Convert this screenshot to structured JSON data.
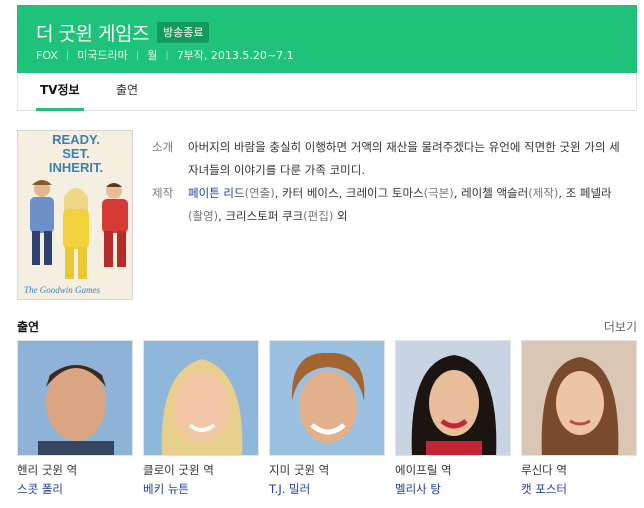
{
  "header": {
    "title": "더 굿윈 게임즈",
    "badge": "방송종료",
    "meta": [
      "FOX",
      "미국드라마",
      "월",
      "7부작, 2013.5.20~7.1"
    ],
    "color": "#1ec27a"
  },
  "tabs": [
    {
      "label": "TV정보",
      "active": true
    },
    {
      "label": "출연",
      "active": false
    }
  ],
  "poster": {
    "headline": [
      "READY.",
      "SET.",
      "INHERIT."
    ],
    "logo_text": "The Goodwin Games"
  },
  "info": {
    "synopsis_label": "소개",
    "synopsis": "아버지의 바람을 충실히 이행하면 거액의 재산을 물려주겠다는 유언에 직면한 굿윈 가의 세 자녀들의 이야기를 다룬 가족 코미디.",
    "credits_label": "제작",
    "credits": [
      {
        "name": "페이튼 리드",
        "role": "(연출)",
        "linked": true
      },
      {
        "name": "카터 베이스",
        "role": "",
        "linked": false
      },
      {
        "name": "크레이그 토마스",
        "role": "(극본)",
        "linked": false
      },
      {
        "name": "레이첼 액슬러",
        "role": "(제작)",
        "linked": false
      },
      {
        "name": "조 페넬라",
        "role": "(촬영)",
        "linked": false
      },
      {
        "name": "크리스토퍼 쿠크",
        "role": "(편집)",
        "linked": false
      }
    ],
    "credits_suffix": "외"
  },
  "cast": {
    "title": "출연",
    "more_label": "더보기",
    "members": [
      {
        "role": "헨리 굿윈 역",
        "actor": "스콧 폴리"
      },
      {
        "role": "클로이 굿윈 역",
        "actor": "베키 뉴튼"
      },
      {
        "role": "지미 굿윈 역",
        "actor": "T.J. 밀러"
      },
      {
        "role": "에이프릴 역",
        "actor": "멜리사 탕"
      },
      {
        "role": "루신다 역",
        "actor": "캣 포스터"
      }
    ]
  }
}
